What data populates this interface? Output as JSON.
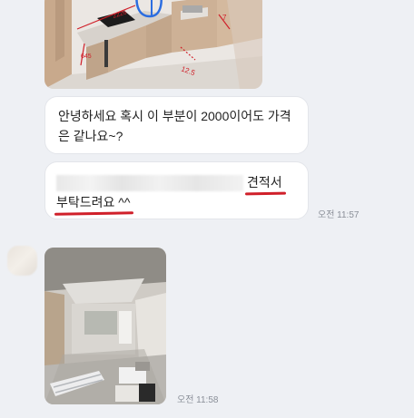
{
  "messages": [
    {
      "type": "image",
      "description_key": "kitchen-render"
    },
    {
      "type": "text",
      "text": "안녕하세요 혹시 이 부분이 2000이어도 가격은 같나요~?"
    },
    {
      "type": "text",
      "redacted_prefix": true,
      "emphasis1": "견적서",
      "emphasis2": "부탁드려요 ^^",
      "time": "오전 11:57"
    },
    {
      "type": "image",
      "description_key": "construction-site",
      "time": "오전 11:58"
    }
  ],
  "kitchen_annotations": [
    "2226",
    "645",
    "12.5",
    "7"
  ],
  "colors": {
    "annotation_red": "#d0202a",
    "annotation_blue": "#2b6de0",
    "bubble_bg": "#ffffff",
    "chat_bg": "#eef0f4"
  }
}
